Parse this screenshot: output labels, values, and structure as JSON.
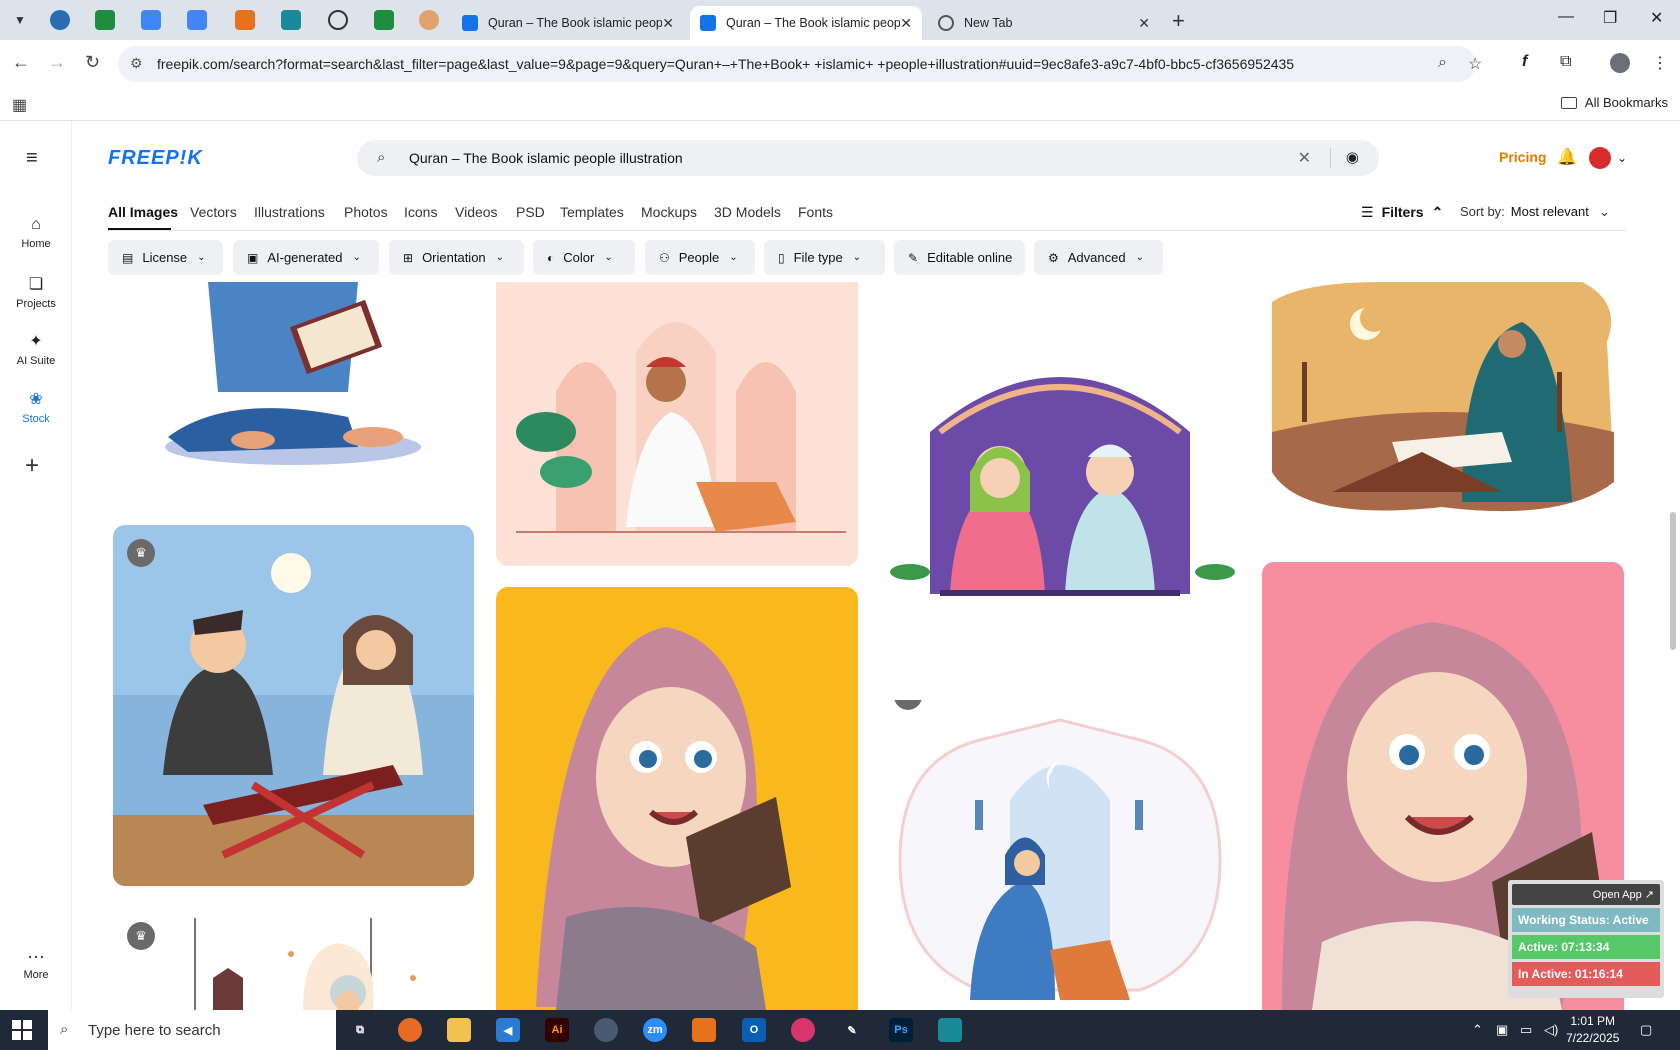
{
  "browser": {
    "tabs": [
      {
        "title": "Quran – The Book islamic peop",
        "active": false
      },
      {
        "title": "Quran – The Book islamic peop",
        "active": true
      },
      {
        "title": "New Tab",
        "active": false
      }
    ],
    "url": "freepik.com/search?format=search&last_filter=page&last_value=9&page=9&query=Quran+–+The+Book+ +islamic+ +people+illustration#uuid=9ec8afe3-a9c7-4bf0-bbc5-cf3656952435",
    "bookmarks_label": "All Bookmarks"
  },
  "sidebar": {
    "items": [
      {
        "label": "Home",
        "icon": "home-icon"
      },
      {
        "label": "Projects",
        "icon": "projects-icon"
      },
      {
        "label": "AI Suite",
        "icon": "sparkles-icon"
      },
      {
        "label": "Stock",
        "icon": "stock-icon"
      }
    ],
    "more_label": "More"
  },
  "header": {
    "logo": "FREEP!K",
    "search_query": "Quran – The Book  islamic  people illustration",
    "pricing_label": "Pricing"
  },
  "type_tabs": [
    "All Images",
    "Vectors",
    "Illustrations",
    "Photos",
    "Icons",
    "Videos",
    "PSD",
    "Templates",
    "Mockups",
    "3D Models",
    "Fonts"
  ],
  "filters_label": "Filters",
  "sort": {
    "label": "Sort by:",
    "value": "Most relevant"
  },
  "chips": [
    "License",
    "AI-generated",
    "Orientation",
    "Color",
    "People",
    "File type",
    "Editable online",
    "Advanced"
  ],
  "working_status": {
    "open_app": "Open App ↗",
    "status": "Working Status: Active",
    "active": "Active: 07:13:34",
    "inactive": "In Active: 01:16:14"
  },
  "taskbar": {
    "search_placeholder": "Type here to search",
    "time": "1:01 PM",
    "date": "7/22/2025"
  },
  "colors": {
    "brand": "#1273eb",
    "pricing": "#e07c00"
  }
}
